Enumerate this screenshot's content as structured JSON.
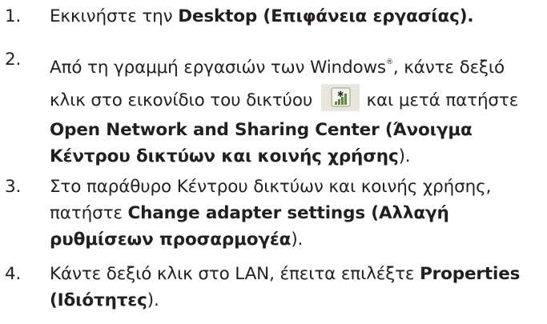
{
  "steps": [
    {
      "number": "1.",
      "text": "Εκκινήστε την ",
      "bold": "Desktop (Επιφάνεια εργασίας)."
    },
    {
      "number": "2.",
      "line1_pre": "Από τη γραμμή εργασιών των Windows",
      "line1_sup": "®",
      "line1_post": ", κάντε δεξιό",
      "line2_pre": "κλικ στο εικονίδιο του δικτύου ",
      "icon": "network-signal-icon",
      "line2_post": " και μετά πατήστε",
      "bold_line3": "Open Network and Sharing Center (Άνοιγμα",
      "bold_line4": "Κέντρου δικτύων και κοινής χρήσης",
      "end": ")."
    },
    {
      "number": "3.",
      "line1": "Στο παράθυρο Κέντρου δικτύων και κοινής χρήσης,",
      "line2_pre": "πατήστε ",
      "bold_line2": "Change adapter settings (Αλλαγή",
      "bold_line3": "ρυθμίσεων προσαρμογέα",
      "end": ")."
    },
    {
      "number": "4.",
      "line1_pre": "Κάντε δεξιό κλικ στο LAN, έπειτα επιλέξτε ",
      "bold_line1": "Properties",
      "bold_line2": "(Ιδιότητες",
      "end": ")."
    }
  ],
  "colors": {
    "text": "#231f20",
    "icon_background": "#e9e7dc",
    "icon_bars": "#5a8a3c"
  }
}
